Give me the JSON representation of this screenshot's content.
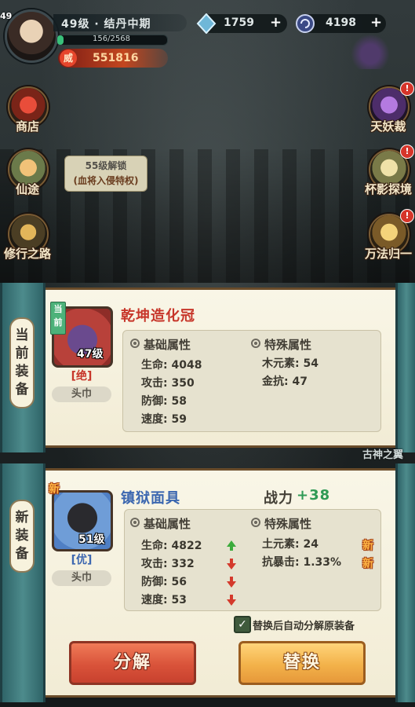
{
  "player": {
    "avatar_level": "49",
    "realm": "49级 · 结丹中期",
    "exp_text": "156/2568",
    "exp_progress": 0.06,
    "power_icon": "威",
    "power_value": "551816"
  },
  "currencies": [
    {
      "icon": "diamond-icon",
      "value": "1759",
      "plus": "+"
    },
    {
      "icon": "spirit-coin-icon",
      "value": "4198",
      "plus": "+"
    }
  ],
  "side_left": [
    {
      "label": "商店",
      "icon": "shop-icon"
    },
    {
      "label": "仙途",
      "icon": "immortal-path-icon"
    },
    {
      "label": "修行之路",
      "icon": "cultivation-path-icon"
    }
  ],
  "side_right": [
    {
      "label": "天妖裁",
      "icon": "demon-judgment-icon",
      "badge": "!"
    },
    {
      "label": "杯影探境",
      "icon": "cup-shadow-icon",
      "badge": "!"
    },
    {
      "label": "万法归一",
      "icon": "unity-icon",
      "badge": "!"
    }
  ],
  "unlock_tip": {
    "line1": "55级解锁",
    "line2": "(血将入侵特权)"
  },
  "colors": {
    "accent_gold": "#f3b24a",
    "accent_red": "#d9533a",
    "quality_jue": "#c7362a",
    "quality_you": "#3c67b0",
    "positive": "#2f9a55"
  },
  "current": {
    "label": "当前装备",
    "tag": "当前",
    "name": "乾坤造化冠",
    "level": "47级",
    "quality": "[绝]",
    "slot": "头巾",
    "base_title": "基础属性",
    "special_title": "特殊属性",
    "base_stats": [
      {
        "label": "生命: 4048"
      },
      {
        "label": "攻击: 350"
      },
      {
        "label": "防御: 58"
      },
      {
        "label": "速度: 59"
      }
    ],
    "special_stats": [
      {
        "label": "木元素: 54"
      },
      {
        "label": "金抗: 47"
      }
    ]
  },
  "new_equip": {
    "label": "新装备",
    "tag": "新",
    "name": "镇狱面具",
    "level": "51级",
    "quality": "[优]",
    "slot": "头巾",
    "power_label": "战力",
    "power_delta": "+38",
    "base_title": "基础属性",
    "special_title": "特殊属性",
    "base_stats": [
      {
        "label": "生命: 4822",
        "trend": "up"
      },
      {
        "label": "攻击: 332",
        "trend": "down"
      },
      {
        "label": "防御: 56",
        "trend": "down"
      },
      {
        "label": "速度: 53",
        "trend": "down"
      }
    ],
    "special_stats": [
      {
        "label": "土元素: 24",
        "new": "新"
      },
      {
        "label": "抗暴击: 1.33%",
        "new": "新"
      }
    ],
    "auto_decompose": "替换后自动分解原装备",
    "auto_decompose_checked": true
  },
  "bg_text": "古神之翼",
  "actions": {
    "decompose": "分解",
    "replace": "替换"
  }
}
